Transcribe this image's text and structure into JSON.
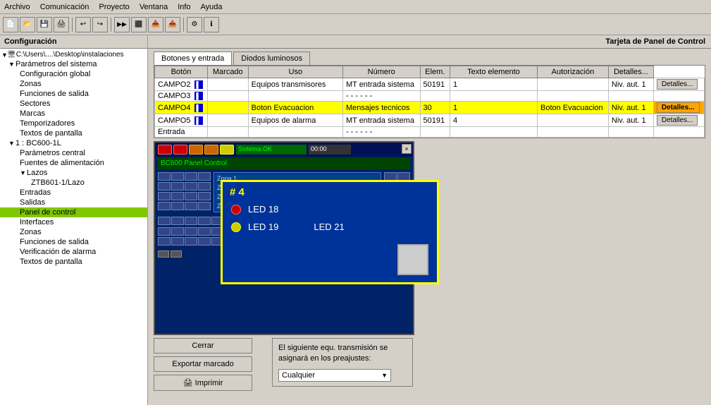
{
  "menubar": {
    "items": [
      "Archivo",
      "Comunicación",
      "Proyecto",
      "Ventana",
      "Info",
      "Ayuda"
    ]
  },
  "left_panel": {
    "title": "Configuración",
    "tree": [
      {
        "id": "path",
        "label": "C:\\Users\\....\\Desktop\\instalaciones",
        "level": 0,
        "hasArrow": true,
        "arrowOpen": true
      },
      {
        "id": "params",
        "label": "Parámetros del sistema",
        "level": 1,
        "hasArrow": true,
        "arrowOpen": true
      },
      {
        "id": "config_global",
        "label": "Configuración global",
        "level": 2
      },
      {
        "id": "zonas1",
        "label": "Zonas",
        "level": 2
      },
      {
        "id": "func_salida1",
        "label": "Funciones de salida",
        "level": 2
      },
      {
        "id": "sectores",
        "label": "Sectores",
        "level": 2
      },
      {
        "id": "marcas",
        "label": "Marcas",
        "level": 2
      },
      {
        "id": "temporizadores",
        "label": "Temporizadores",
        "level": 2
      },
      {
        "id": "textos_pantalla1",
        "label": "Textos de pantalla",
        "level": 2
      },
      {
        "id": "bc600",
        "label": "1 : BC600-1L",
        "level": 1,
        "hasArrow": true,
        "arrowOpen": true
      },
      {
        "id": "params_central",
        "label": "Parámetros central",
        "level": 2
      },
      {
        "id": "fuentes",
        "label": "Fuentes de alimentación",
        "level": 2
      },
      {
        "id": "lazos",
        "label": "Lazos",
        "level": 2,
        "hasArrow": true,
        "arrowOpen": true
      },
      {
        "id": "ztb601",
        "label": "ZTB601-1/Lazo",
        "level": 3
      },
      {
        "id": "entradas",
        "label": "Entradas",
        "level": 2
      },
      {
        "id": "salidas",
        "label": "Salidas",
        "level": 2
      },
      {
        "id": "panel_control",
        "label": "Panel de control",
        "level": 2,
        "selected": true
      },
      {
        "id": "interfaces",
        "label": "Interfaces",
        "level": 2
      },
      {
        "id": "zonas2",
        "label": "Zonas",
        "level": 2
      },
      {
        "id": "func_salida2",
        "label": "Funciones de salida",
        "level": 2
      },
      {
        "id": "verificacion",
        "label": "Verificación de alarma",
        "level": 2
      },
      {
        "id": "textos_pantalla2",
        "label": "Textos de pantalla",
        "level": 2
      }
    ]
  },
  "right_panel": {
    "title": "Tarjeta de Panel de Control",
    "tabs": [
      {
        "label": "Botones y entrada",
        "active": true
      },
      {
        "label": "Diodos luminosos",
        "active": false
      }
    ],
    "table": {
      "headers": [
        "Botón",
        "Marcado",
        "Uso",
        "Número",
        "Elem.",
        "Texto elemento",
        "Autorización",
        "Detalles..."
      ],
      "rows": [
        {
          "cells": [
            "CAMPO2",
            "btn",
            "Equipos transmisores",
            "MT entrada sistema",
            "50191",
            "1",
            "",
            "Niv. aut. 1",
            "Detalles..."
          ],
          "highlight": false
        },
        {
          "cells": [
            "CAMPO3",
            "btn",
            "",
            "- - - - - -",
            "",
            "",
            "",
            "",
            ""
          ],
          "highlight": false
        },
        {
          "cells": [
            "CAMPO4",
            "btn",
            "Boton Evacuacion",
            "Mensajes tecnicos",
            "30",
            "1",
            "Boton Evacuacion",
            "Niv. aut. 1",
            "Detalles..."
          ],
          "highlight": true
        },
        {
          "cells": [
            "CAMPO5",
            "btn",
            "Equipos de alarma",
            "MT entrada sistema",
            "50191",
            "4",
            "",
            "Niv. aut. 1",
            "Detalles..."
          ],
          "highlight": false
        },
        {
          "cells": [
            "Entrada",
            "",
            "",
            "- - - - - -",
            "",
            "",
            "",
            "",
            ""
          ],
          "highlight": false
        }
      ]
    }
  },
  "preview": {
    "close_label": "×",
    "yellow_box": {
      "title": "# 4",
      "leds": [
        {
          "dot_color": "red",
          "label": "LED 18"
        },
        {
          "dot_color": "yellow",
          "label": "LED 19",
          "right_label": "LED 21"
        }
      ]
    }
  },
  "bottom_buttons": {
    "cerrar": "Cerrar",
    "exportar": "Exportar marcado",
    "imprimir": "Imprimir"
  },
  "info_box": {
    "label": "El siguiente equ. transmisión se\nasignará en los preajustes:",
    "dropdown_value": "Cualquier",
    "dropdown_placeholder": "Cualquier"
  }
}
